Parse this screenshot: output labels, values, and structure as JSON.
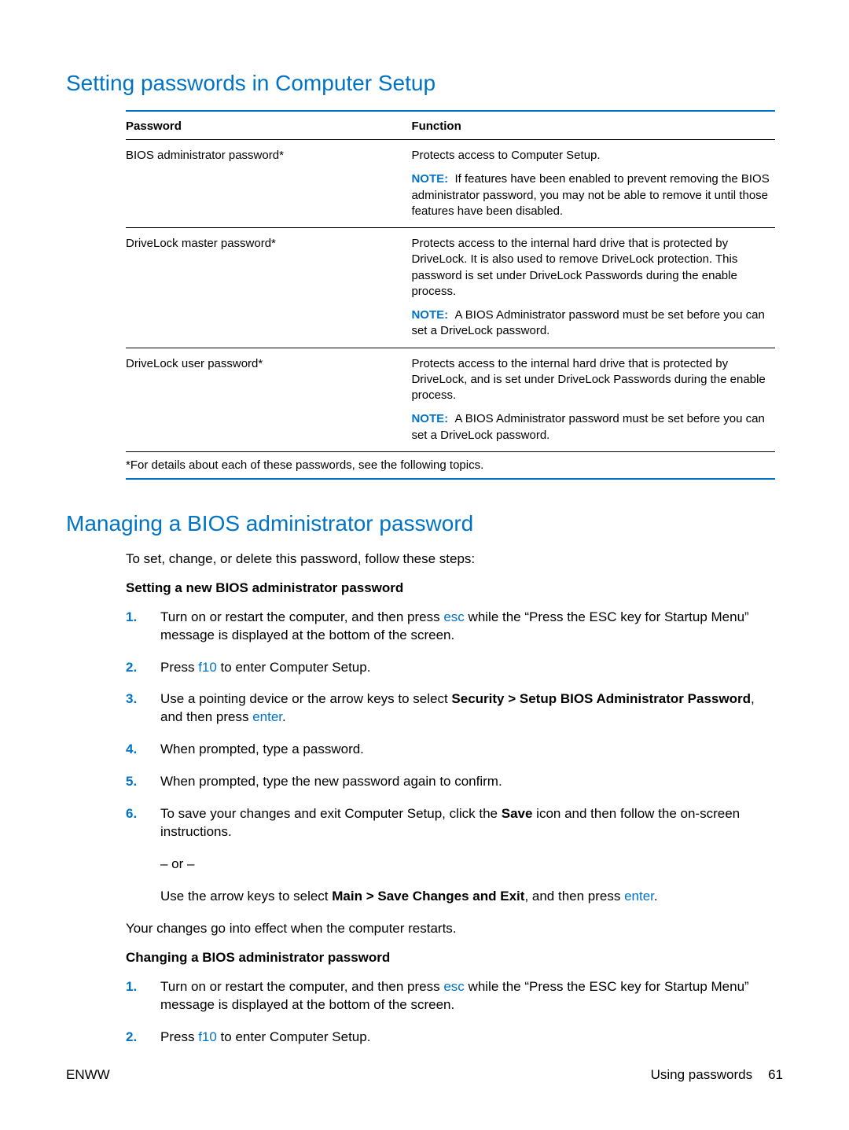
{
  "section1": {
    "title": "Setting passwords in Computer Setup",
    "table": {
      "head": {
        "c1": "Password",
        "c2": "Function"
      },
      "rows": [
        {
          "c1": "BIOS administrator password*",
          "f1": "Protects access to Computer Setup.",
          "noteLabel": "NOTE:",
          "noteText": "If features have been enabled to prevent removing the BIOS administrator password, you may not be able to remove it until those features have been disabled."
        },
        {
          "c1": "DriveLock master password*",
          "f1": "Protects access to the internal hard drive that is protected by DriveLock. It is also used to remove DriveLock protection. This password is set under DriveLock Passwords during the enable process.",
          "noteLabel": "NOTE:",
          "noteText": "A BIOS Administrator password must be set before you can set a DriveLock password."
        },
        {
          "c1": "DriveLock user password*",
          "f1": "Protects access to the internal hard drive that is protected by DriveLock, and is set under DriveLock Passwords during the enable process.",
          "noteLabel": "NOTE:",
          "noteText": "A BIOS Administrator password must be set before you can set a DriveLock password."
        }
      ],
      "footnote": "*For details about each of these passwords, see the following topics."
    }
  },
  "section2": {
    "title": "Managing a BIOS administrator password",
    "intro": "To set, change, or delete this password, follow these steps:",
    "sub1": {
      "heading": "Setting a new BIOS administrator password",
      "steps": {
        "s1a": "Turn on or restart the computer, and then press ",
        "s1k": "esc",
        "s1b": " while the “Press the ESC key for Startup Menu” message is displayed at the bottom of the screen.",
        "s2a": "Press ",
        "s2k": "f10",
        "s2b": " to enter Computer Setup.",
        "s3a": "Use a pointing device or the arrow keys to select ",
        "s3bold": "Security > Setup BIOS Administrator Password",
        "s3b": ", and then press ",
        "s3k": "enter",
        "s3c": ".",
        "s4": "When prompted, type a password.",
        "s5": "When prompted, type the new password again to confirm.",
        "s6a": "To save your changes and exit Computer Setup, click the ",
        "s6bold": "Save",
        "s6b": " icon and then follow the on-screen instructions.",
        "s6or": "– or –",
        "s6c": "Use the arrow keys to select ",
        "s6bold2": "Main > Save Changes and Exit",
        "s6d": ", and then press ",
        "s6k": "enter",
        "s6e": "."
      },
      "after": "Your changes go into effect when the computer restarts."
    },
    "sub2": {
      "heading": "Changing a BIOS administrator password",
      "steps": {
        "s1a": "Turn on or restart the computer, and then press ",
        "s1k": "esc",
        "s1b": " while the “Press the ESC key for Startup Menu” message is displayed at the bottom of the screen.",
        "s2a": "Press ",
        "s2k": "f10",
        "s2b": " to enter Computer Setup."
      }
    }
  },
  "footer": {
    "left": "ENWW",
    "rightText": "Using passwords",
    "pageNum": "61"
  }
}
